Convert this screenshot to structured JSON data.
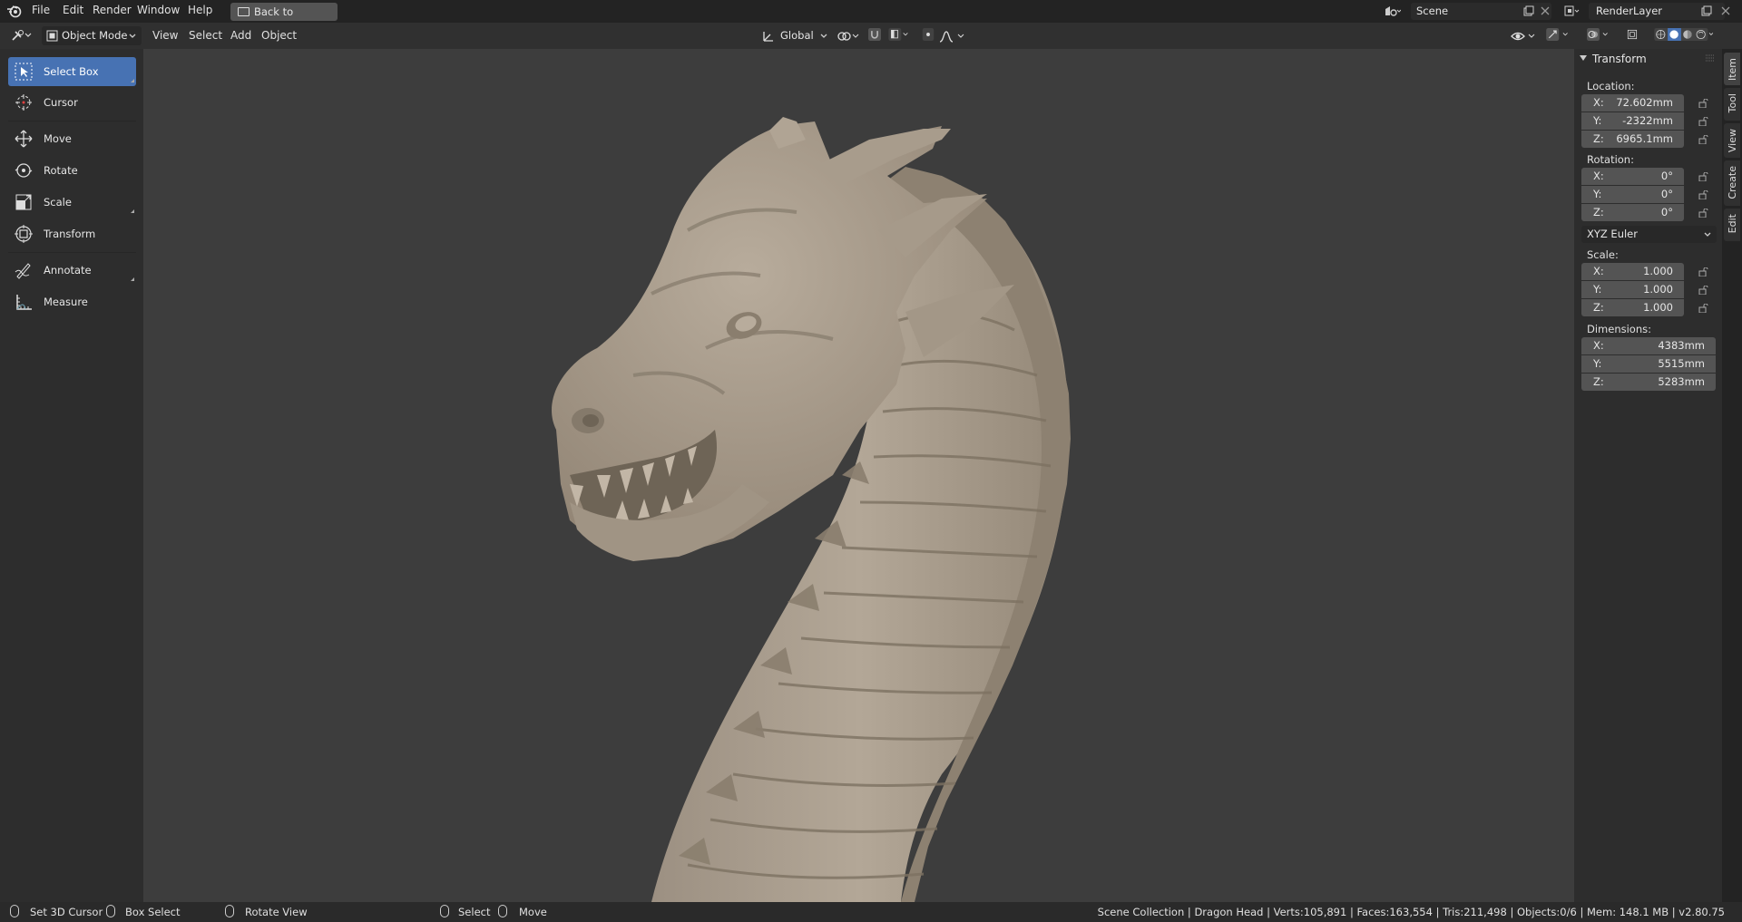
{
  "topbar": {
    "menus": [
      "File",
      "Edit",
      "Render",
      "Window",
      "Help"
    ],
    "back_label": "Back to Previous",
    "scene": "Scene",
    "render_layer": "RenderLayer"
  },
  "header": {
    "mode": "Object Mode",
    "menus": [
      "View",
      "Select",
      "Add",
      "Object"
    ],
    "orientation": "Global"
  },
  "toolbar": {
    "tools": [
      {
        "label": "Select Box",
        "icon": "select-box-icon",
        "active": true
      },
      {
        "label": "Cursor",
        "icon": "cursor-icon"
      },
      {
        "label": "Move",
        "icon": "move-icon"
      },
      {
        "label": "Rotate",
        "icon": "rotate-icon"
      },
      {
        "label": "Scale",
        "icon": "scale-icon"
      },
      {
        "label": "Transform",
        "icon": "transform-icon"
      },
      {
        "label": "Annotate",
        "icon": "annotate-icon"
      },
      {
        "label": "Measure",
        "icon": "measure-icon"
      }
    ]
  },
  "npanel": {
    "title": "Transform",
    "location_label": "Location:",
    "location": [
      {
        "axis": "X:",
        "value": "72.602mm"
      },
      {
        "axis": "Y:",
        "value": "-2322mm"
      },
      {
        "axis": "Z:",
        "value": "6965.1mm"
      }
    ],
    "rotation_label": "Rotation:",
    "rotation": [
      {
        "axis": "X:",
        "value": "0°"
      },
      {
        "axis": "Y:",
        "value": "0°"
      },
      {
        "axis": "Z:",
        "value": "0°"
      }
    ],
    "rotation_mode": "XYZ Euler",
    "scale_label": "Scale:",
    "scale": [
      {
        "axis": "X:",
        "value": "1.000"
      },
      {
        "axis": "Y:",
        "value": "1.000"
      },
      {
        "axis": "Z:",
        "value": "1.000"
      }
    ],
    "dimensions_label": "Dimensions:",
    "dimensions": [
      {
        "axis": "X:",
        "value": "4383mm"
      },
      {
        "axis": "Y:",
        "value": "5515mm"
      },
      {
        "axis": "Z:",
        "value": "5283mm"
      }
    ]
  },
  "tabs": [
    "Item",
    "Tool",
    "View",
    "Create",
    "Edit"
  ],
  "statusbar": {
    "hints": [
      "Set 3D Cursor",
      "Box Select",
      "Rotate View",
      "Select",
      "Move"
    ],
    "stats": "Scene Collection | Dragon Head | Verts:105,891 | Faces:163,554 | Tris:211,498 | Objects:0/6 | Mem: 148.1 MB | v2.80.75"
  },
  "colors": {
    "accent": "#4772b3",
    "viewport_bg": "#3d3d3d",
    "model": "#a89c8c"
  }
}
